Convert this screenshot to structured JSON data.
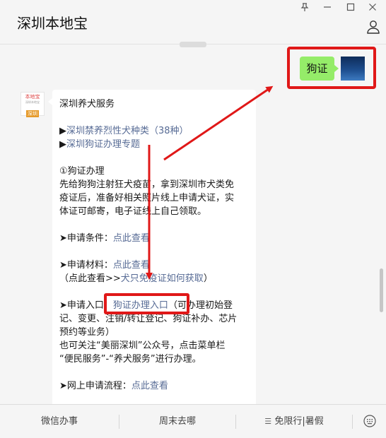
{
  "window": {
    "title": "深圳本地宝",
    "pin_icon": "pin-icon",
    "min_icon": "minimize-icon",
    "max_icon": "maximize-icon",
    "close_icon": "close-icon"
  },
  "my_message": {
    "text": "狗证"
  },
  "bot_message": {
    "avatar_text": {
      "top": "本地宝",
      "small": "深圳本地宝",
      "bottom": "深圳"
    },
    "lines": [
      {
        "prefix": "",
        "text": "深圳养犬服务",
        "link": "",
        "suffix": ""
      },
      {
        "prefix": "▶",
        "text": "",
        "link": "深圳禁养烈性犬种类（38种）",
        "suffix": ""
      },
      {
        "prefix": "▶",
        "text": "",
        "link": "深圳狗证办理专题",
        "suffix": ""
      },
      {
        "prefix": "",
        "text": "①狗证办理",
        "link": "",
        "suffix": ""
      },
      {
        "prefix": "",
        "text": "先给狗狗注射狂犬疫苗，拿到深圳市犬类免",
        "link": "",
        "suffix": ""
      },
      {
        "prefix": "",
        "text": "疫证后，准备好相关照片线上申请犬证，实",
        "link": "",
        "suffix": ""
      },
      {
        "prefix": "",
        "text": "体证可邮寄，电子证线上自己领取。",
        "link": "",
        "suffix": ""
      },
      {
        "prefix": "➤",
        "text": "申请条件：",
        "link": "点此查看",
        "suffix": ""
      },
      {
        "prefix": "➤",
        "text": "申请材料：",
        "link": "点此查看",
        "suffix": ""
      },
      {
        "prefix": "",
        "text": "（点此查看>>",
        "link": "犬只免疫证如何获取",
        "suffix": "）"
      },
      {
        "prefix": "➤",
        "text": "申请入口：",
        "link": "狗证办理入口",
        "suffix": "（可办理初始登"
      },
      {
        "prefix": "",
        "text": "记、变更、注销/转让登记、狗证补办、芯片",
        "link": "",
        "suffix": ""
      },
      {
        "prefix": "",
        "text": "预约等业务）",
        "link": "",
        "suffix": ""
      },
      {
        "prefix": "",
        "text": "也可关注“美丽深圳”公众号，点击菜单栏",
        "link": "",
        "suffix": ""
      },
      {
        "prefix": "",
        "text": "“便民服务”-“养犬服务”进行办理。",
        "link": "",
        "suffix": ""
      },
      {
        "prefix": "➤",
        "text": "网上申请流程：",
        "link": "点此查看",
        "suffix": ""
      }
    ]
  },
  "bottom_menu": {
    "items": [
      {
        "label": "微信办事"
      },
      {
        "label": "周末去哪"
      },
      {
        "label": "免限行|暑假",
        "icon": "menu-list-icon"
      }
    ]
  },
  "colors": {
    "link": "#576b95",
    "highlight": "#e01818",
    "my_bubble": "#95ec69"
  }
}
